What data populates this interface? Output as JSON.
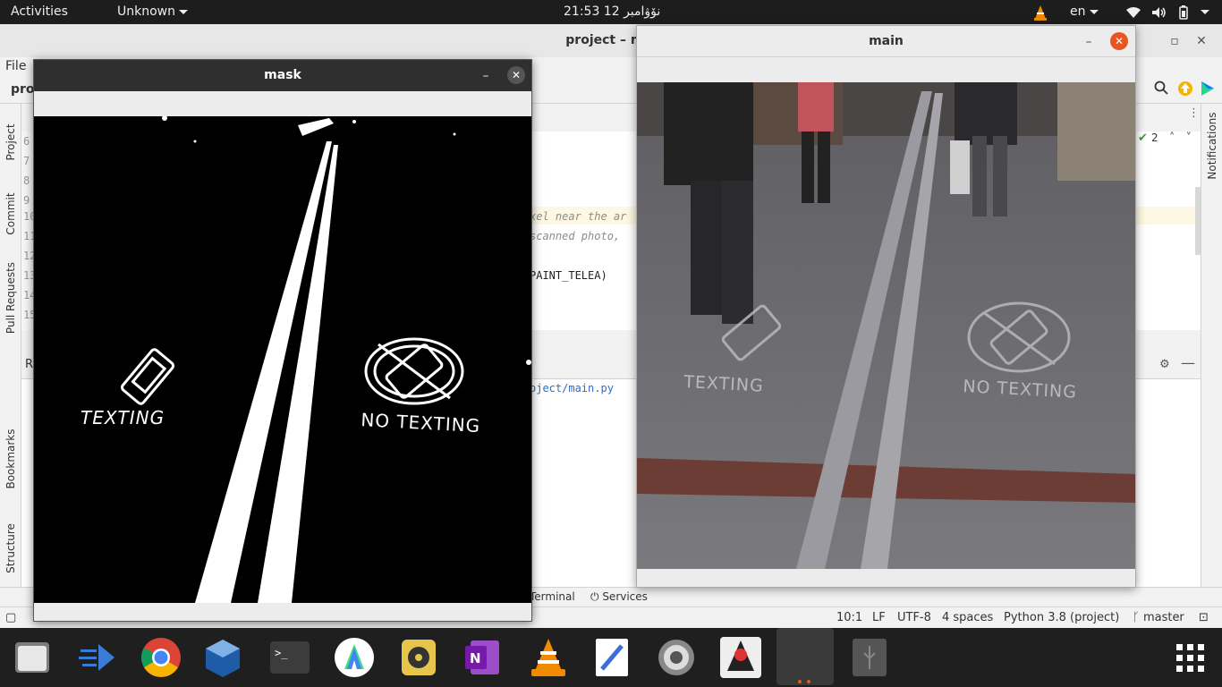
{
  "topbar": {
    "activities": "Activities",
    "app_menu": "Unknown",
    "datetime": "21:53  12 نۆۋامبر",
    "language": "en"
  },
  "ide": {
    "title": "project – mai",
    "menu_file": "File",
    "project_label": "proj",
    "side_tabs": [
      "Project",
      "Commit",
      "Pull Requests",
      "Bookmarks",
      "Structure"
    ],
    "right_tab": "Notifications",
    "line_numbers": [
      "6",
      "7",
      "8",
      "9",
      "10",
      "11",
      "12",
      "13",
      "14",
      "15"
    ],
    "code_lines": [
      "xel near the ar",
      "scanned photo,",
      "PAINT_TELEA)"
    ],
    "run_label": "R",
    "run_output": "oject/main.py",
    "problems_count": "2",
    "bottom_tabs": {
      "terminal": "Terminal",
      "services": "Services"
    },
    "status": {
      "position": "10:1",
      "line_sep": "LF",
      "encoding": "UTF-8",
      "indent": "4 spaces",
      "interpreter": "Python 3.8 (project)",
      "branch": "master"
    }
  },
  "mask_window": {
    "title": "mask",
    "text_texting": "TEXTING",
    "text_no_texting": "NO TEXTING"
  },
  "main_window": {
    "title": "main",
    "text_texting": "TEXTING",
    "text_no_texting": "NO TEXTING"
  },
  "dock": {
    "items": [
      "files",
      "nautilus-like",
      "chrome",
      "virtualbox",
      "terminal",
      "android-studio",
      "rhythmbox",
      "onenote",
      "vlc",
      "text-editor",
      "settings",
      "java-app",
      "active-app",
      "usb"
    ]
  },
  "colors": {
    "accent": "#e95420",
    "topbar": "#1d1d1d",
    "dock": "#1f1f1f"
  }
}
